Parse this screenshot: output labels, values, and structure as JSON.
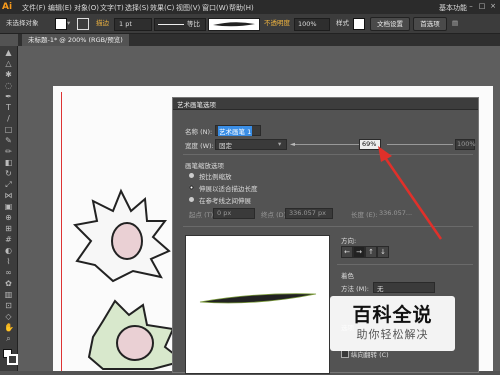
{
  "app": {
    "logo": "Ai"
  },
  "menu": {
    "items": [
      "文件(F)",
      "编辑(E)",
      "对象(O)",
      "文字(T)",
      "选择(S)",
      "效果(C)",
      "视图(V)",
      "窗口(W)",
      "帮助(H)"
    ],
    "workspace": "基本功能"
  },
  "controlbar": {
    "selection": "未选择对象",
    "stroke_label": "描边",
    "stroke_weight": "1 pt",
    "stroke_profile": "等比",
    "opacity_label": "不透明度",
    "opacity_value": "100%",
    "style_label": "样式",
    "doc_setup": "文档设置",
    "preferences": "首选项"
  },
  "document": {
    "tab": "未标题-1* @ 200% (RGB/预览)"
  },
  "dialog": {
    "title": "艺术画笔选项",
    "name_label": "名称 (N):",
    "name_value": "艺术画笔 1",
    "width_label": "宽度 (W):",
    "width_mode": "固定",
    "width_value": "69%",
    "width_max": "100%",
    "scale_section": "画笔缩放选项",
    "scale_options": [
      "按比例缩放",
      "伸展以适合描边长度",
      "在参考线之间伸展"
    ],
    "start_label": "起点 (T):",
    "start_value": "0 px",
    "end_label": "终点 (D):",
    "end_value": "336.057 px",
    "length_label": "长度 (E):",
    "length_value": "336.057...",
    "direction_label": "方向:",
    "direction_arrows": [
      "←",
      "→",
      "↑",
      "↓"
    ],
    "colorize_label": "着色",
    "method_label": "方法 (M):",
    "method_value": "无",
    "options_label": "选项",
    "flip_label": "纵向翻转 (C)"
  },
  "watermark": {
    "line1": "百科全说",
    "line2": "助你轻松解决"
  },
  "colors": {
    "accent": "#f79a1b",
    "arrow": "#e0302a",
    "guide": "#dd3333"
  }
}
